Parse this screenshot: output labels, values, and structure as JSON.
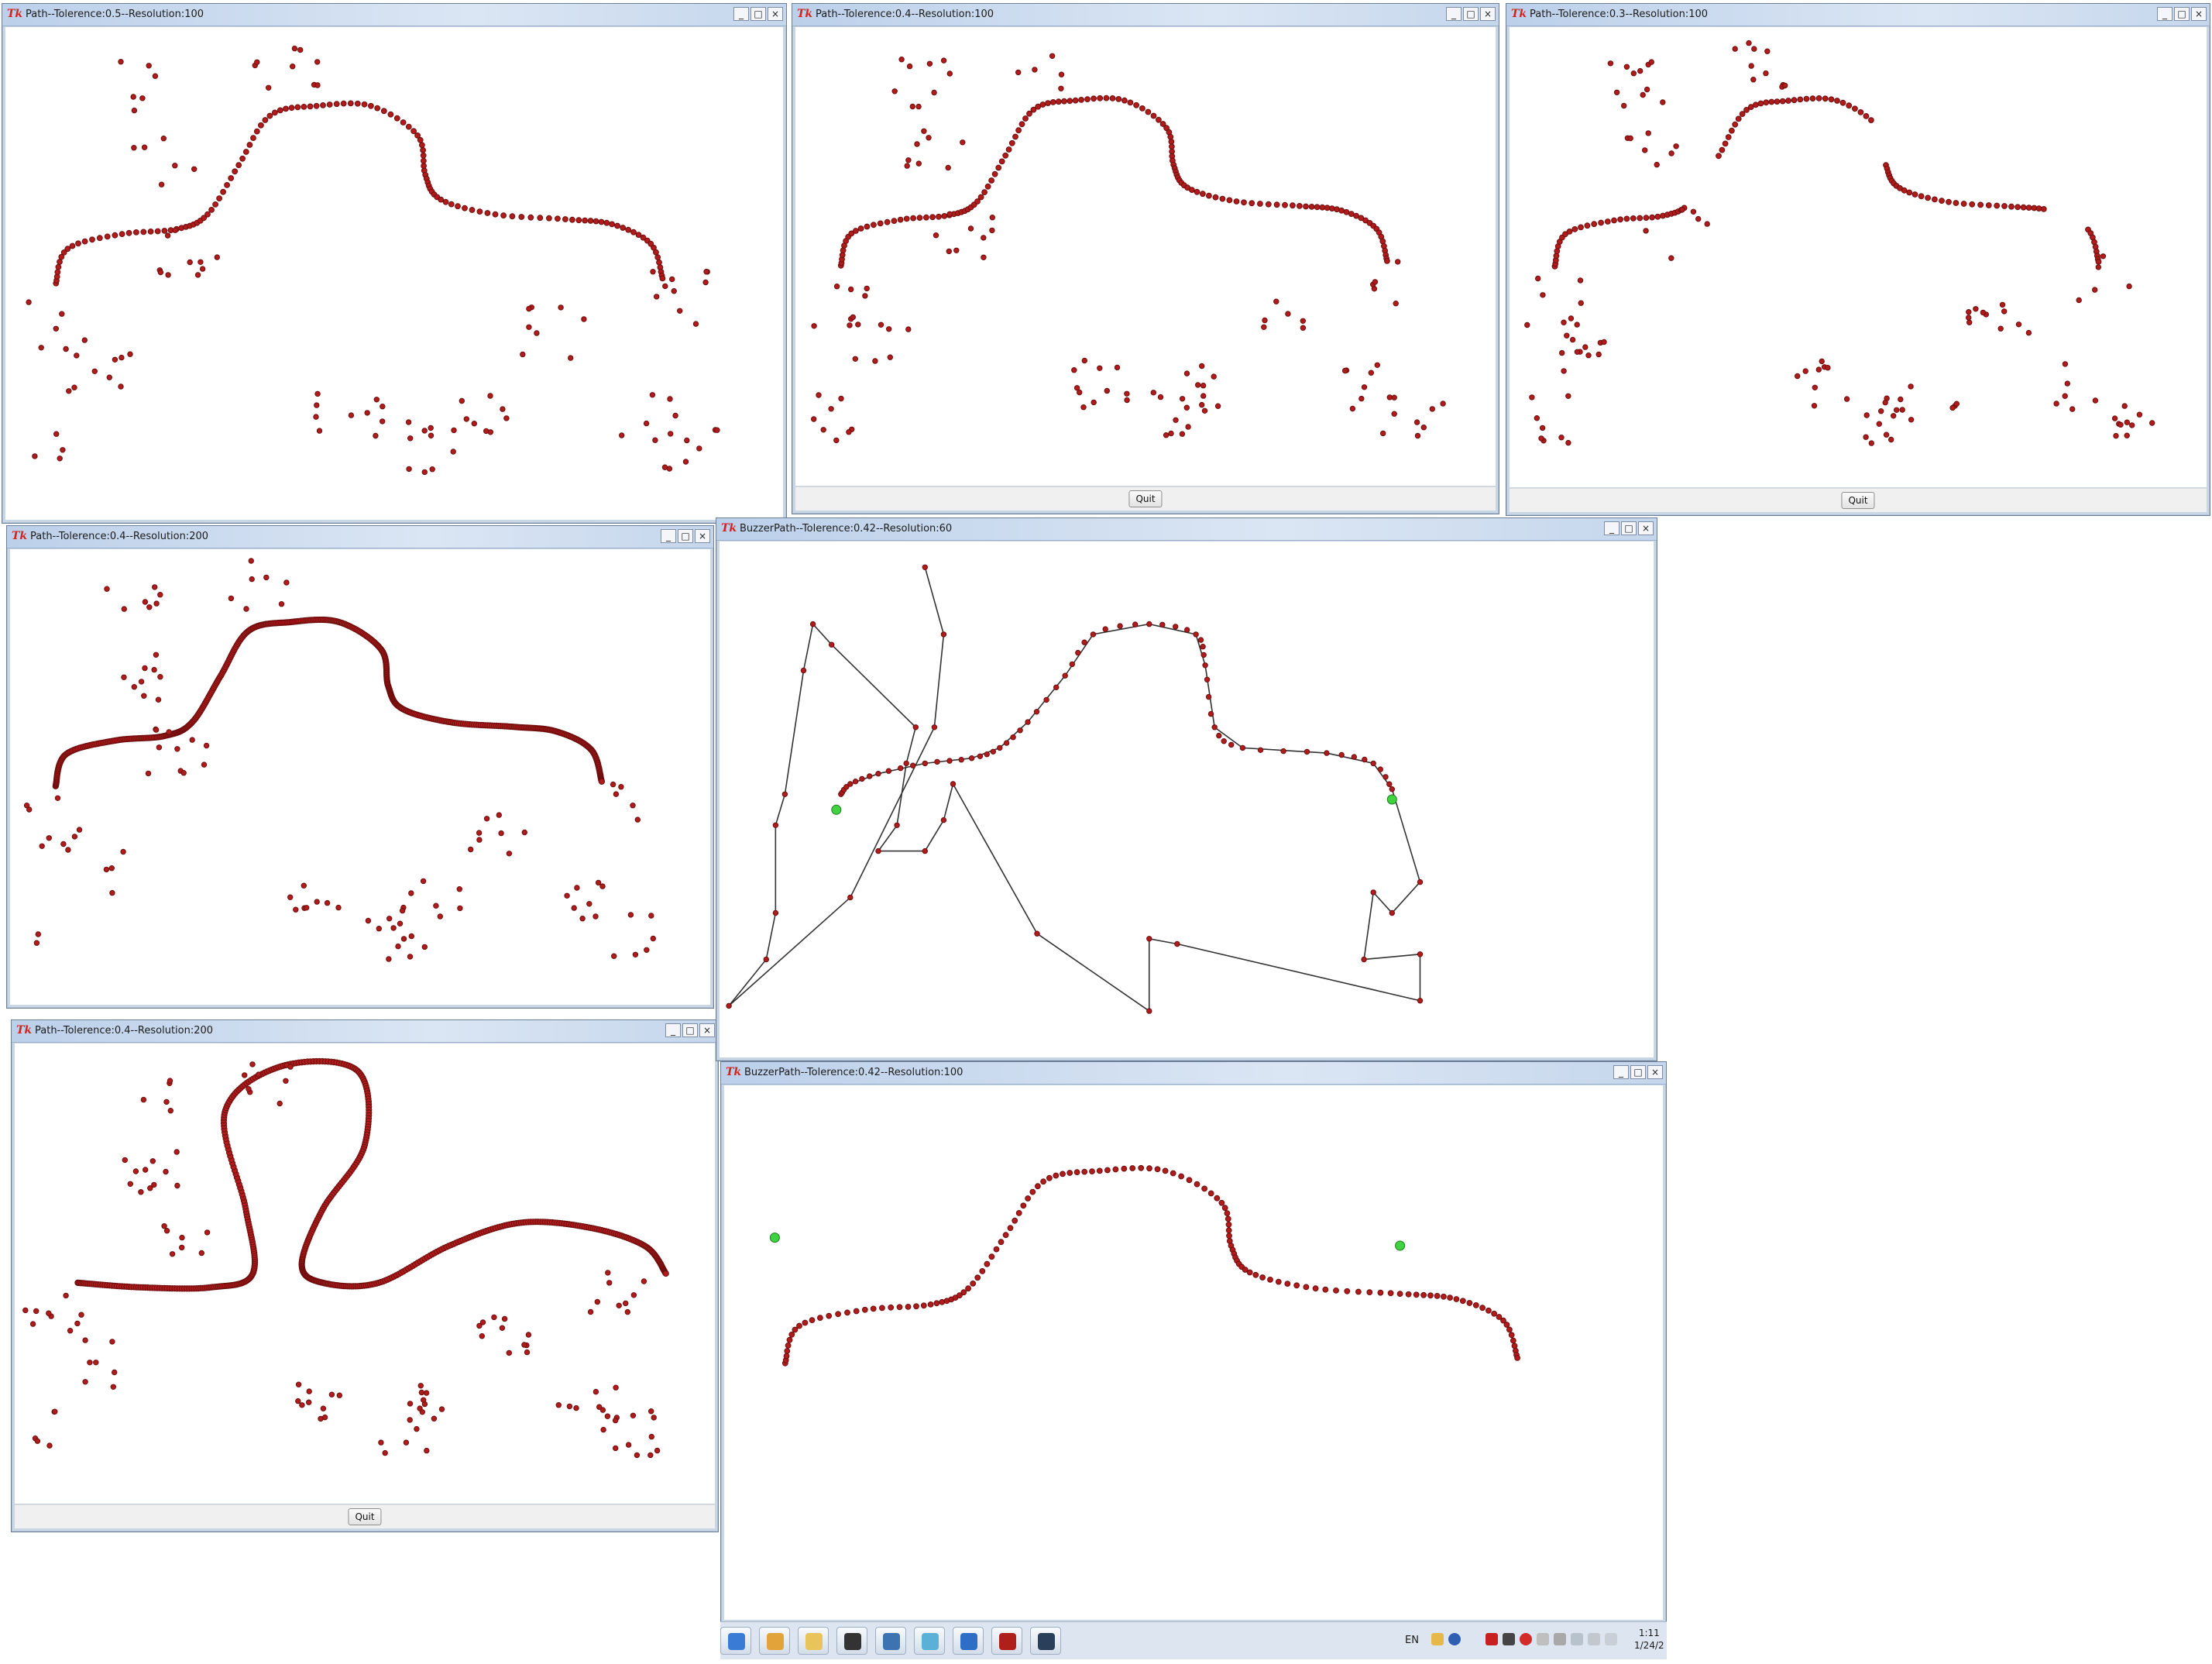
{
  "windows": [
    {
      "id": "w1",
      "title": "Path--Tolerence:0.5--Resolution:100",
      "quit_label": "",
      "path": "top",
      "style": "dots"
    },
    {
      "id": "w2",
      "title": "Path--Tolerence:0.4--Resolution:100",
      "quit_label": "Quit",
      "path": "top",
      "style": "dots"
    },
    {
      "id": "w3",
      "title": "Path--Tolerence:0.3--Resolution:100",
      "quit_label": "Quit",
      "path": "top",
      "style": "dots-gaps"
    },
    {
      "id": "w4",
      "title": "Path--Tolerence:0.4--Resolution:200",
      "quit_label": "",
      "path": "top",
      "style": "dense"
    },
    {
      "id": "w5",
      "title": "BuzzerPath--Tolerence:0.42--Resolution:60",
      "quit_label": "",
      "path": "buzzer",
      "style": "lines"
    },
    {
      "id": "w6",
      "title": "Path--Tolerence:0.4--Resolution:200",
      "quit_label": "Quit",
      "path": "loop",
      "style": "dense"
    },
    {
      "id": "w7",
      "title": "BuzzerPath--Tolerence:0.42--Resolution:100",
      "quit_label": "",
      "path": "top",
      "style": "clean"
    }
  ],
  "controls": {
    "minimize": "_",
    "maximize": "□",
    "close": "×",
    "tk_logo": "Tk"
  },
  "taskbar": {
    "apps": [
      {
        "icon": "globe-icon",
        "color": "#3a7bd5"
      },
      {
        "icon": "paint-icon",
        "color": "#e2a33a"
      },
      {
        "icon": "folder-icon",
        "color": "#e8c45a"
      },
      {
        "icon": "pen-icon",
        "color": "#333333"
      },
      {
        "icon": "python-icon",
        "color": "#3c74b2"
      },
      {
        "icon": "notes-icon",
        "color": "#5bb0d8"
      },
      {
        "icon": "browser-icon",
        "color": "#2f6ec7"
      },
      {
        "icon": "dota-icon",
        "color": "#b0201b"
      },
      {
        "icon": "steam-icon",
        "color": "#2a3f5a"
      }
    ],
    "language": "EN",
    "clock_time": "1:11",
    "clock_date": "1/24/2"
  },
  "colors": {
    "dot": "#b01c1c",
    "dot_outline": "#6e0d0d",
    "endpoint": "#3fd43f",
    "line": "#333333"
  }
}
